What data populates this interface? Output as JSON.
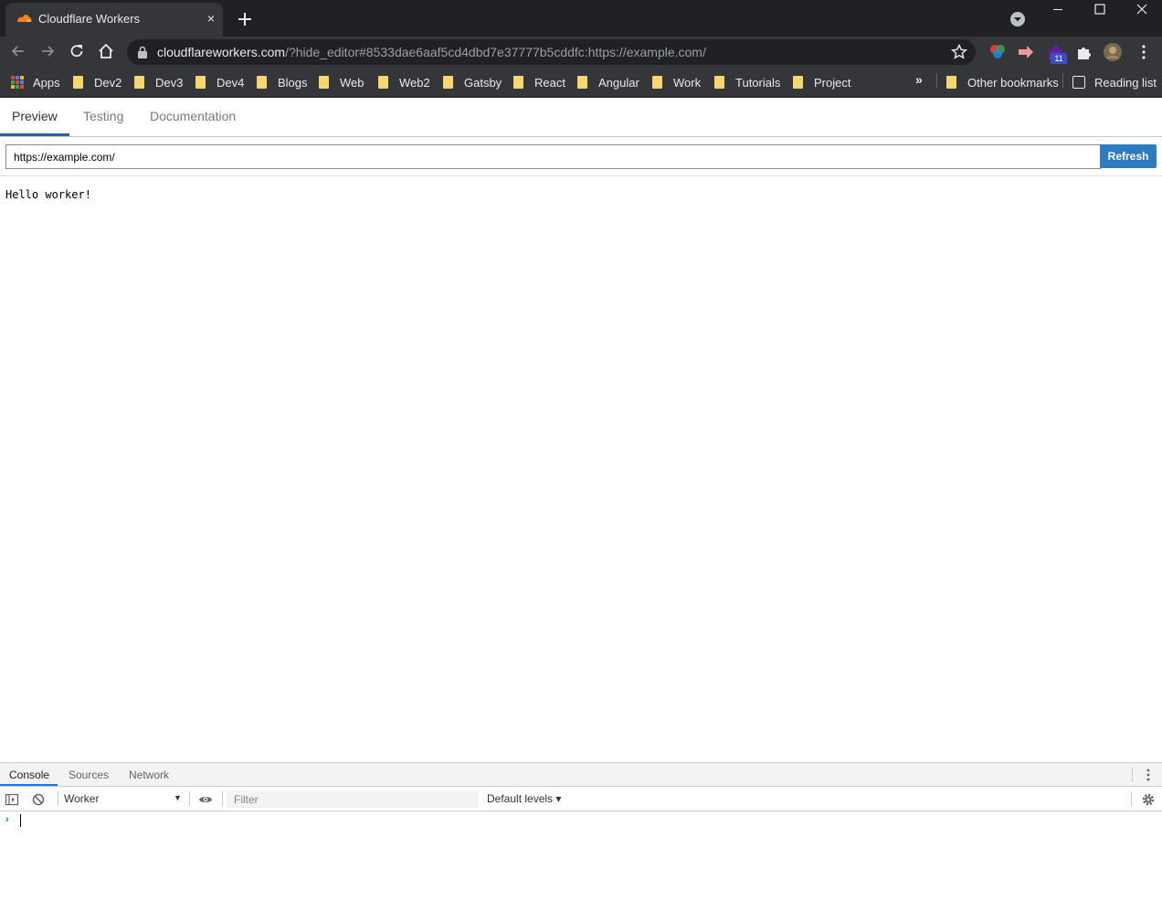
{
  "browser": {
    "tab": {
      "title": "Cloudflare Workers",
      "close": "×"
    },
    "url": {
      "host": "cloudflareworkers.com",
      "rest": "/?hide_editor#8533dae6aaf5cd4dbd7e37777b5cddfc:https://example.com/"
    },
    "extension_badge": "11",
    "bookmarks": [
      {
        "label": "Apps",
        "icon": "apps-icon"
      },
      {
        "label": "Dev2",
        "icon": "folder-icon"
      },
      {
        "label": "Dev3",
        "icon": "folder-icon"
      },
      {
        "label": "Dev4",
        "icon": "folder-icon"
      },
      {
        "label": "Blogs",
        "icon": "folder-icon"
      },
      {
        "label": "Web",
        "icon": "folder-icon"
      },
      {
        "label": "Web2",
        "icon": "folder-icon"
      },
      {
        "label": "Gatsby",
        "icon": "folder-icon"
      },
      {
        "label": "React",
        "icon": "folder-icon"
      },
      {
        "label": "Angular",
        "icon": "folder-icon"
      },
      {
        "label": "Work",
        "icon": "folder-icon"
      },
      {
        "label": "Tutorials",
        "icon": "folder-icon"
      },
      {
        "label": "Project",
        "icon": "folder-icon"
      }
    ],
    "more_bookmarks": "»",
    "other_bookmarks": "Other bookmarks",
    "reading_list": "Reading list"
  },
  "page": {
    "tabs": [
      "Preview",
      "Testing",
      "Documentation"
    ],
    "active_tab": "Preview",
    "url_input": "https://example.com/",
    "refresh_label": "Refresh",
    "output": "Hello worker!"
  },
  "devtools": {
    "tabs": [
      "Console",
      "Sources",
      "Network"
    ],
    "active_tab": "Console",
    "context": "Worker",
    "filter_placeholder": "Filter",
    "levels": "Default levels ▾",
    "prompt": "›"
  },
  "colors": {
    "chrome_dark": "#202124",
    "chrome_toolbar": "#35363a",
    "accent_blue": "#2f7bbf",
    "cloudflare_orange": "#f48120"
  }
}
